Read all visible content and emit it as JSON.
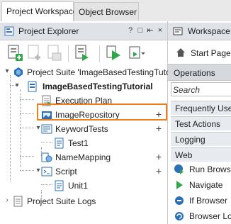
{
  "tabs": [
    "Project Workspace",
    "Object Browser"
  ],
  "explorer": {
    "title": "Project Explorer",
    "title_buttons": [
      "?",
      "□",
      "⇤",
      "×"
    ]
  },
  "toolbar": {
    "icons": [
      "add-project-icon",
      "add-item-icon",
      "add-existing-icon",
      "run-tests-icon",
      "run-dropdown-icon"
    ]
  },
  "tree": {
    "suite": "Project Suite 'ImageBasedTestingTutoria",
    "project": "ImageBasedTestingTutorial",
    "items": {
      "execution_plan": "Execution Plan",
      "image_repository": "ImageRepository",
      "keyword_tests": "KeywordTests",
      "test1": "Test1",
      "name_mapping": "NameMapping",
      "script": "Script",
      "unit1": "Unit1",
      "suite_logs": "Project Suite Logs"
    },
    "plus": "+"
  },
  "workspace": {
    "title": "Workspace",
    "start_page": "Start Page",
    "operations": "Operations",
    "search_placeholder": "Search",
    "categories": [
      "Frequently Used",
      "Test Actions",
      "Logging",
      "Web"
    ],
    "operations_list": [
      "Run Browser",
      "Navigate",
      "If Browser",
      "Browser Loop"
    ]
  },
  "colors": {
    "highlight": "#ef7d1a",
    "accent_green": "#2fa84a",
    "accent_blue": "#2b6fb6"
  }
}
